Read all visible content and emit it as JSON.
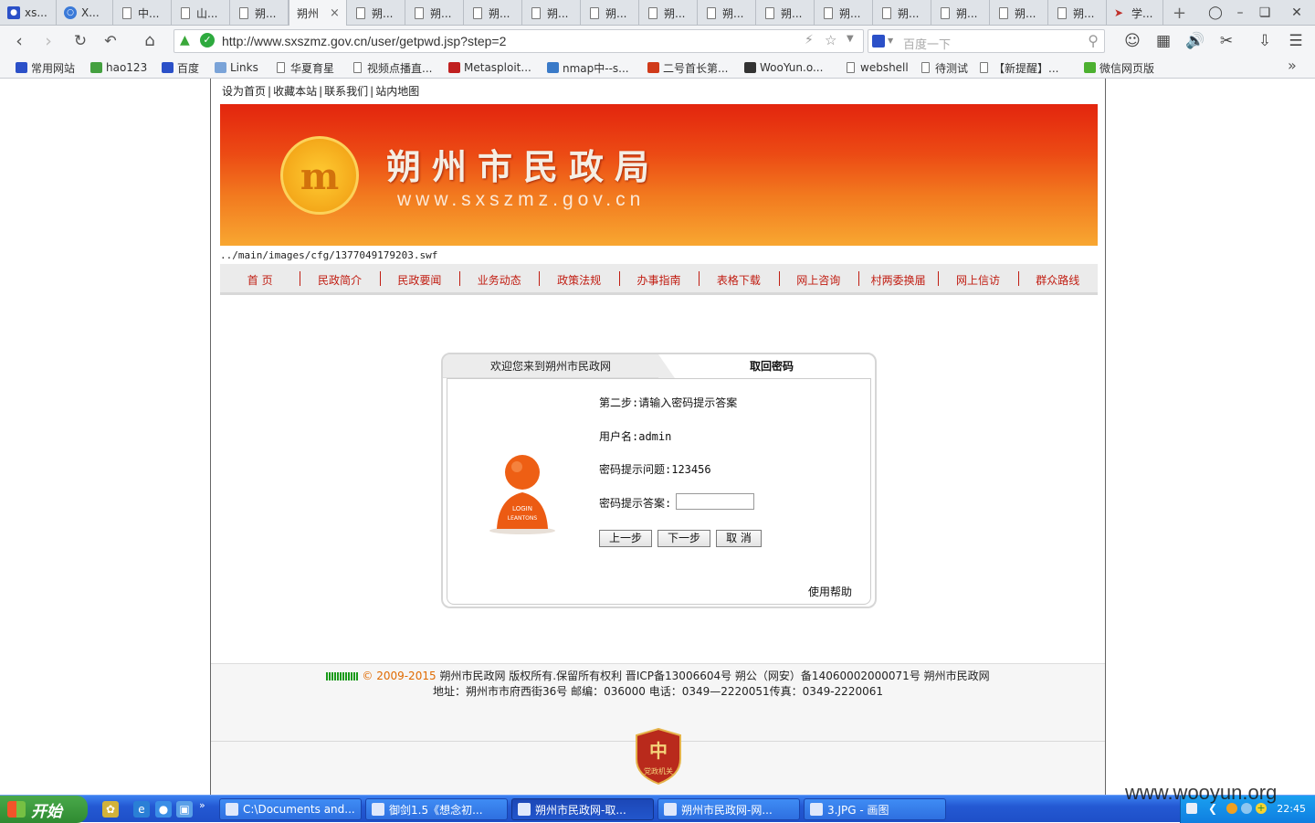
{
  "browser": {
    "tabs": [
      {
        "label": "xs...",
        "icon": "paw-icon"
      },
      {
        "label": "X...",
        "icon": "globe-icon"
      },
      {
        "label": "中...",
        "icon": "page-icon"
      },
      {
        "label": "山...",
        "icon": "page-icon"
      },
      {
        "label": "朔...",
        "icon": "page-icon"
      },
      {
        "label": "朔州",
        "icon": "none",
        "active": true
      },
      {
        "label": "朔...",
        "icon": "page-icon"
      },
      {
        "label": "朔...",
        "icon": "page-icon"
      },
      {
        "label": "朔...",
        "icon": "page-icon"
      },
      {
        "label": "朔...",
        "icon": "page-icon"
      },
      {
        "label": "朔...",
        "icon": "page-icon"
      },
      {
        "label": "朔...",
        "icon": "page-icon"
      },
      {
        "label": "朔...",
        "icon": "page-icon"
      },
      {
        "label": "朔...",
        "icon": "page-icon"
      },
      {
        "label": "朔...",
        "icon": "page-icon"
      },
      {
        "label": "朔...",
        "icon": "page-icon"
      },
      {
        "label": "朔...",
        "icon": "page-icon"
      },
      {
        "label": "朔...",
        "icon": "page-icon"
      },
      {
        "label": "朔...",
        "icon": "page-icon"
      },
      {
        "label": "学...",
        "icon": "bird-icon"
      }
    ],
    "new_tab": "+",
    "url": "http://www.sxszmz.gov.cn/user/getpwd.jsp?step=2",
    "search_placeholder": "百度一下",
    "bookmarks": [
      {
        "label": "常用网站",
        "icon": "paw-icon"
      },
      {
        "label": "hao123",
        "icon": "hao-icon"
      },
      {
        "label": "百度",
        "icon": "paw-icon"
      },
      {
        "label": "Links",
        "icon": "folder-icon"
      },
      {
        "label": "华夏育星",
        "icon": "page-icon"
      },
      {
        "label": "视频点播直...",
        "icon": "page-icon"
      },
      {
        "label": "Metasploit...",
        "icon": "metasploit-icon"
      },
      {
        "label": "nmap中--s...",
        "icon": "nmap-icon"
      },
      {
        "label": "二号首长第...",
        "icon": "red-icon"
      },
      {
        "label": "WooYun.o...",
        "icon": "wooyun-icon"
      },
      {
        "label": "webshell",
        "icon": "page-icon"
      },
      {
        "label": "待测试",
        "icon": "page-icon"
      },
      {
        "label": "【新提醒】...",
        "icon": "page-icon"
      },
      {
        "label": "微信网页版",
        "icon": "wechat-icon"
      }
    ]
  },
  "site": {
    "top_links": [
      "设为首页",
      "收藏本站",
      "联系我们",
      "站内地图"
    ],
    "title": "朔州市民政局",
    "domain": "www.sxszmz.gov.cn",
    "emblem_letter": "m",
    "swf_path": "../main/images/cfg/1377049179203.swf",
    "nav": [
      "首 页",
      "民政简介",
      "民政要闻",
      "业务动态",
      "政策法规",
      "办事指南",
      "表格下载",
      "网上咨询",
      "村两委换届",
      "网上信访",
      "群众路线"
    ],
    "colors": {
      "banner_top": "#e3250e",
      "banner_bottom": "#f8a731",
      "nav_text": "#c11d12"
    }
  },
  "panel": {
    "tab_welcome": "欢迎您来到朔州市民政网",
    "tab_active": "取回密码",
    "step": "第二步:请输入密码提示答案",
    "username": "用户名:admin",
    "question": "密码提示问题:123456",
    "answer_label": "密码提示答案:",
    "answer_value": "",
    "avatar_text": "LOGIN LEANTONS",
    "btn_prev": "上一步",
    "btn_next": "下一步",
    "btn_cancel": "取 消",
    "help": "使用帮助"
  },
  "footer": {
    "copyright_symbol": "©",
    "years": "2009-2015",
    "line1": "朔州市民政网 版权所有.保留所有权利 晋ICP备13006604号 朔公（网安）备14060002000071号 朔州市民政网",
    "line2": "地址：朔州市市府西街36号 邮编：036000  电话：0349—2220051传真：0349-2220061",
    "badge_text": "党政机关"
  },
  "taskbar": {
    "start": "开始",
    "tasks": [
      {
        "label": "C:\\Documents and...",
        "active": false
      },
      {
        "label": "御剑1.5《想念初...",
        "active": false
      },
      {
        "label": "朔州市民政网-取...",
        "active": true
      },
      {
        "label": "朔州市民政网-网...",
        "active": false
      },
      {
        "label": "3.JPG - 画图",
        "active": false
      }
    ],
    "clock": "22:45"
  },
  "watermark": "www.wooyun.org"
}
